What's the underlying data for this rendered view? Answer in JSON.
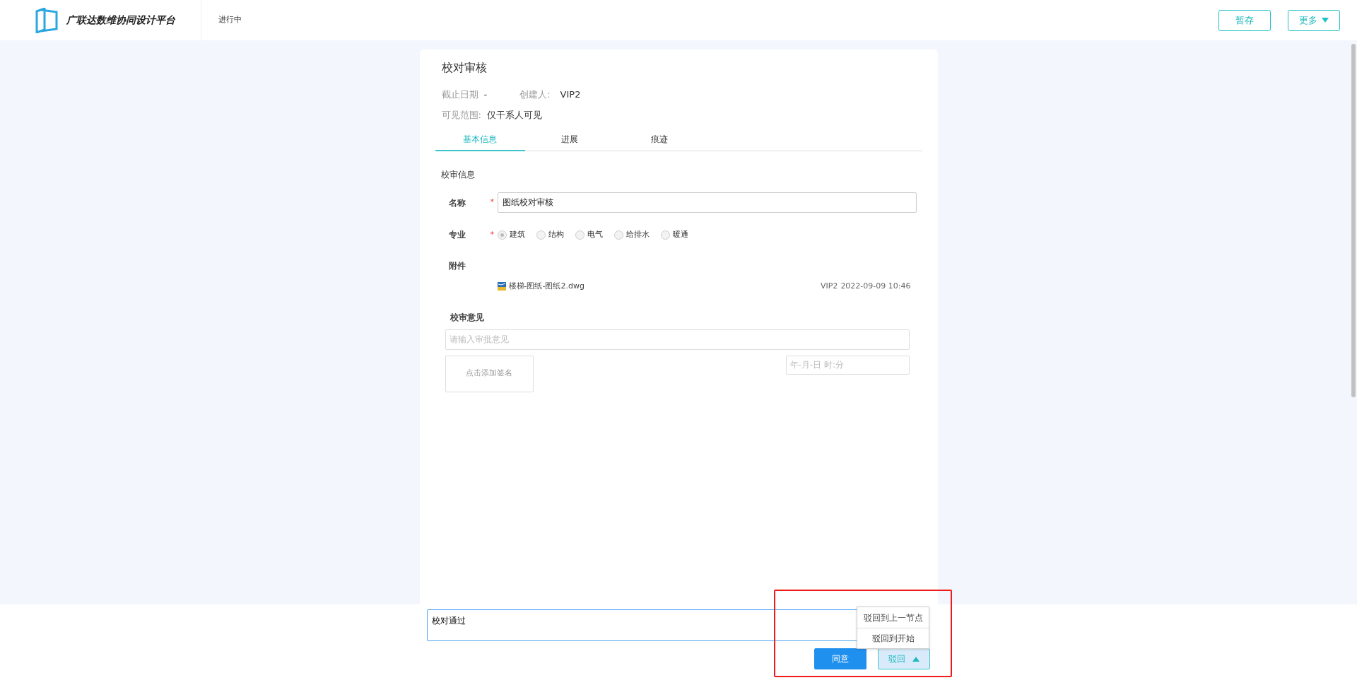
{
  "header": {
    "logo_text": "广联达数维协同设计平台",
    "status": "进行中",
    "buttons": [
      {
        "label": "暂存",
        "kind": "plain"
      },
      {
        "label": "更多",
        "kind": "dropdown"
      }
    ]
  },
  "card": {
    "title": "校对审核",
    "deadline": {
      "label": "截止日期",
      "value": "-"
    },
    "creator": {
      "label": "创建人:",
      "value": "VIP2"
    },
    "visibility": {
      "label": "可见范围:",
      "value": "仅干系人可见"
    },
    "tabs": [
      {
        "label": "基本信息",
        "selected": true
      },
      {
        "label": "进展",
        "selected": false
      },
      {
        "label": "痕迹",
        "selected": false
      }
    ],
    "section_title": "校审信息",
    "name_field": {
      "label": "名称",
      "required_mark": "*",
      "value": "图纸校对审核"
    },
    "major_field": {
      "label": "专业",
      "required_mark": "*",
      "options": [
        {
          "label": "建筑",
          "selected": true
        },
        {
          "label": "结构",
          "selected": false
        },
        {
          "label": "电气",
          "selected": false
        },
        {
          "label": "给排水",
          "selected": false
        },
        {
          "label": "暖通",
          "selected": false
        }
      ]
    },
    "attachments": {
      "label": "附件",
      "files": [
        {
          "name": "楼梯-图纸-图纸2.dwg",
          "uploader": "VIP2",
          "time": "2022-09-09 10:46"
        }
      ]
    },
    "review": {
      "label": "校审意见",
      "opinion_placeholder": "请输入审批意见",
      "signature_hint": "点击添加签名",
      "datetime_placeholder": "年-月-日 时:分"
    }
  },
  "footer": {
    "comment": "校对通过",
    "buttons": [
      {
        "label": "同意",
        "kind": "primary"
      },
      {
        "label": "驳回",
        "kind": "dropdown",
        "expanded": true
      }
    ],
    "menu": [
      "驳回到上一节点",
      "驳回到开始"
    ]
  }
}
